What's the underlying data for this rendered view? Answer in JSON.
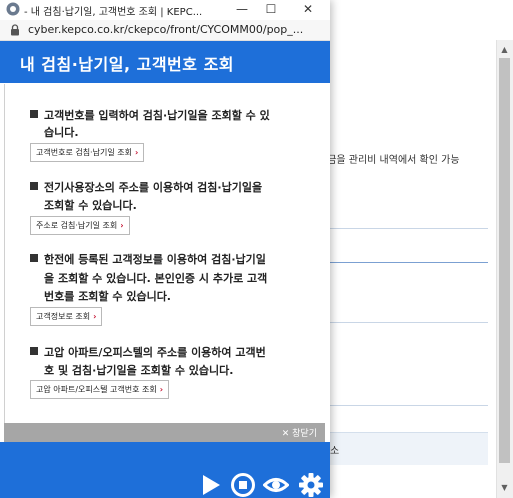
{
  "background": {
    "partial_text": "요금을 관리비 내역에서 확인 가능",
    "footer_partial": "소"
  },
  "popup": {
    "title": "- 내 검침·납기일, 고객번호 조회 | KEPC...",
    "url": "cyber.kepco.co.kr/ckepco/front/CYCOMM00/pop_...",
    "heading": "내 검침·납기일, 고객번호 조회",
    "window_controls": {
      "minimize": "—",
      "maximize": "☐",
      "close": "✕"
    },
    "sections": [
      {
        "title_line1": "고객번호를 입력하여 검침·납기일을 조회할 수 있",
        "title_line2": "습니다.",
        "button": "고객번호로 검침·납기일 조회"
      },
      {
        "title_line1": "전기사용장소의 주소를 이용하여 검침·납기일을",
        "title_line2": "조회할 수 있습니다.",
        "button": "주소로 검침·납기일 조회"
      },
      {
        "title_line1": "한전에 등록된 고객정보를 이용하여 검침·납기일",
        "title_line2": "을 조회할 수 있습니다. 본인인증 시 추가로 고객",
        "title_line3": "번호를 조회할 수 있습니다.",
        "button": "고객정보로 조회"
      },
      {
        "title_line1": "고압 아파트/오피스텔의 주소를 이용하여 고객번",
        "title_line2": "호 및 검침·납기일을 조회할 수 있습니다.",
        "button": "고압 아파트/오피스텔 고객번호 조회"
      }
    ],
    "button_arrow": "›",
    "close_label": "✕ 창닫기"
  },
  "colors": {
    "brand_blue": "#1e6fd9",
    "close_bar": "#a6a6a6",
    "arrow_red": "#c4102f"
  },
  "icons": [
    "app-icon",
    "lock-icon",
    "play-icon",
    "stop-icon",
    "eye-icon",
    "gear-icon"
  ]
}
